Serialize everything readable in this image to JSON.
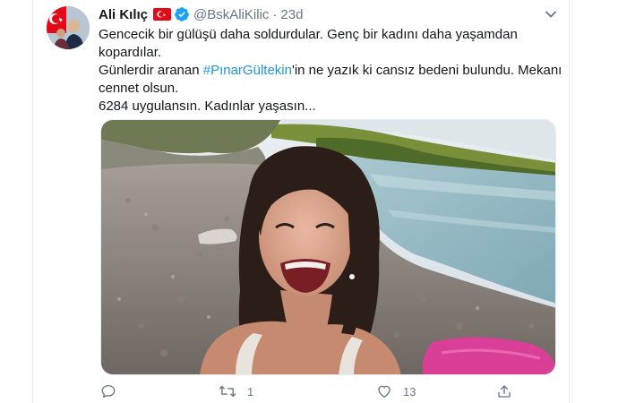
{
  "tweet": {
    "display_name": "Ali Kılıç",
    "handle": "@BskAliKilic",
    "separator": "·",
    "timestamp": "23d",
    "text": {
      "line1": "Gencecik bir gülüşü daha soldurdular. Genç bir kadını daha yaşamdan",
      "line2": "kopardılar.",
      "line3_before": "Günlerdir aranan ",
      "hashtag": "#PınarGültekin",
      "line3_after": "'in ne yazık ki cansız bedeni bulundu. Mekanı",
      "line4": "cennet olsun.",
      "line5": "6284 uygulansın. Kadınlar yaşasın..."
    },
    "actions": {
      "reply_count": "",
      "retweet_count": "1",
      "like_count": "13"
    }
  },
  "icons": {
    "flag": "turkey-flag-icon",
    "verified": "verified-badge-icon",
    "caret": "chevron-down-icon",
    "reply": "reply-icon",
    "retweet": "retweet-icon",
    "like": "heart-icon",
    "share": "share-icon"
  },
  "colors": {
    "link": "#1b95e0",
    "secondary_text": "#657786",
    "primary_text": "#14171a",
    "flag_red": "#e30a17",
    "verified_blue": "#1da1f2"
  }
}
